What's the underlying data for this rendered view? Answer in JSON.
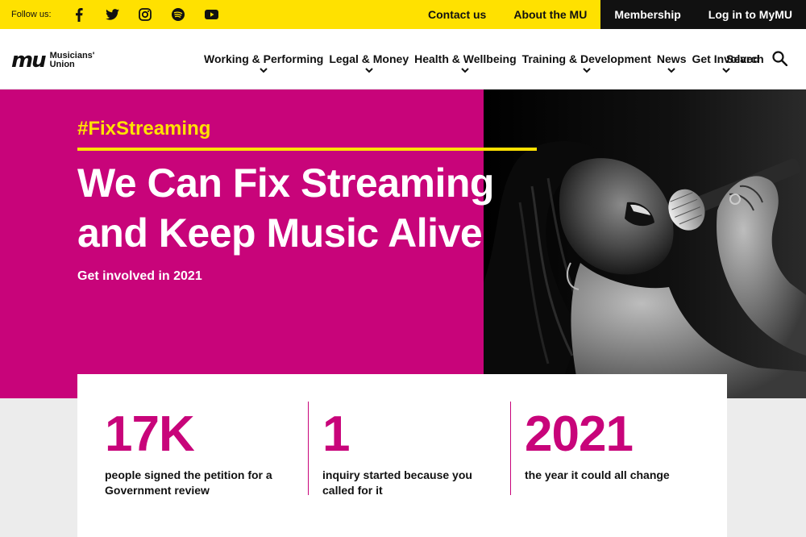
{
  "topbar": {
    "follow_label": "Follow us:",
    "social": [
      "facebook-icon",
      "twitter-icon",
      "instagram-icon",
      "spotify-icon",
      "youtube-icon"
    ],
    "links": {
      "contact": "Contact us",
      "about": "About the MU",
      "membership": "Membership",
      "login": "Log in to MyMU"
    }
  },
  "nav": {
    "logo_mark": "mu",
    "logo_line1": "Musicians'",
    "logo_line2": "Union",
    "items": [
      {
        "label": "Working & Performing"
      },
      {
        "label": "Legal & Money"
      },
      {
        "label": "Health & Wellbeing"
      },
      {
        "label": "Training & Development"
      },
      {
        "label": "News"
      },
      {
        "label": "Get Involved"
      }
    ],
    "search_label": "Search"
  },
  "hero": {
    "hashtag": "#FixStreaming",
    "headline_line1": "We Can Fix Streaming",
    "headline_line2": "and Keep Music Alive",
    "subline": "Get involved in 2021"
  },
  "stats": [
    {
      "number": "17K",
      "desc_line1": "people signed the petition for a",
      "desc_line2": "Government review"
    },
    {
      "number": "1",
      "desc_line1": "inquiry started because you",
      "desc_line2": "called for it"
    },
    {
      "number": "2021",
      "desc_line1": "the year it could all change",
      "desc_line2": ""
    }
  ],
  "colors": {
    "yellow": "#ffe100",
    "magenta": "#c8047a",
    "black": "#111111"
  }
}
